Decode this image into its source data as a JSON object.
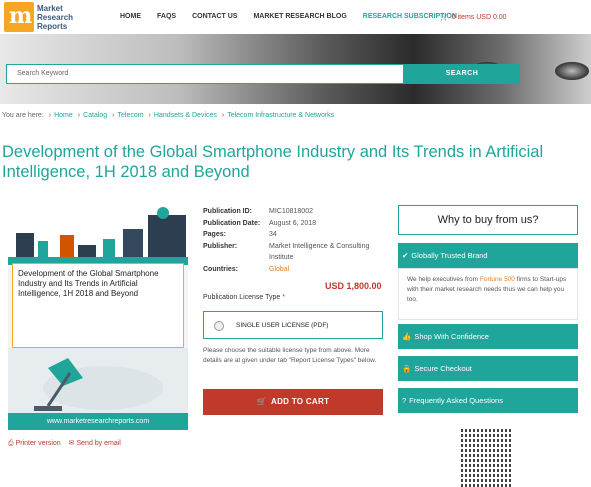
{
  "header": {
    "logo_text": "Market Research Reports",
    "logo_letter": "m",
    "nav": [
      "HOME",
      "FAQS",
      "CONTACT US",
      "MARKET RESEARCH BLOG",
      "RESEARCH SUBSCRIPTION"
    ],
    "cart": "0 items USD 0.00"
  },
  "search": {
    "placeholder": "Search Keyword",
    "button": "SEARCH"
  },
  "breadcrumb": {
    "label": "You are here:",
    "items": [
      "Home",
      "Catalog",
      "Telecom",
      "Handsets & Devices",
      "Telecom Infrastructure & Networks"
    ]
  },
  "title": "Development of the Global Smartphone Industry and Its Trends in Artificial Intelligence, 1H 2018 and Beyond",
  "cover": {
    "text": "Development of the Global Smartphone Industry and Its Trends in Artificial Intelligence, 1H 2018 and Beyond",
    "footer": "www.marketresearchreports.com"
  },
  "below_cover": {
    "print": "Printer version",
    "send": "Send by email"
  },
  "meta": {
    "rows": [
      {
        "k": "Publication ID:",
        "v": "MIC10818002"
      },
      {
        "k": "Publication Date:",
        "v": "August 6, 2018"
      },
      {
        "k": "Pages:",
        "v": "34"
      },
      {
        "k": "Publisher:",
        "v": "Market Intelligence & Consulting Institute"
      },
      {
        "k": "Countries:",
        "v": "Global"
      }
    ],
    "price": "USD 1,800.00",
    "license_type": "Publication License Type",
    "license_option": "SINGLE USER LICENSE (PDF)",
    "note": "Please choose the suitable license type from above. More details are at given under tab \"Report License Types\" below.",
    "add_to_cart": "ADD TO CART"
  },
  "why": {
    "title": "Why to buy from us?",
    "trusted": "Globally Trusted Brand",
    "trust_text_pre": "We help executives from ",
    "trust_text_hl": "Fortune 500",
    "trust_text_post": " firms to Start-ups with their market research needs thus we can help you too.",
    "shop": "Shop With Confidence",
    "secure": "Secure Checkout",
    "faq": "Frequently Asked Questions"
  },
  "colors": {
    "accent": "#1fa59a",
    "cta": "#c0392b",
    "highlight": "#e67e22"
  }
}
